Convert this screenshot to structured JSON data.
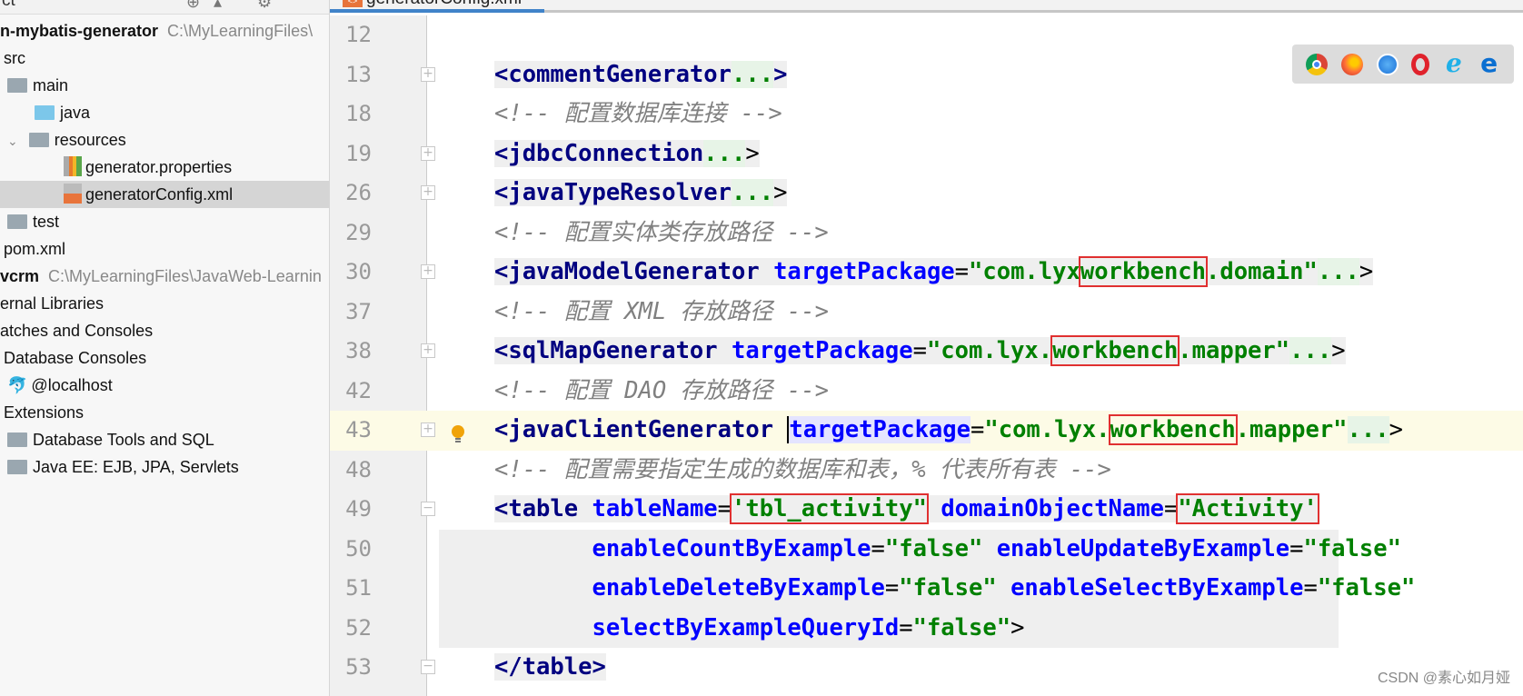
{
  "sidebar": {
    "header": "ct",
    "rows": [
      {
        "label": "n-mybatis-generator",
        "path": "C:\\MyLearningFiles\\"
      },
      {
        "label": "src"
      },
      {
        "label": "main"
      },
      {
        "label": "java"
      },
      {
        "label": "resources"
      },
      {
        "label": "generator.properties"
      },
      {
        "label": "generatorConfig.xml"
      },
      {
        "label": "test"
      },
      {
        "label": "pom.xml"
      },
      {
        "label": "vcrm",
        "path": "C:\\MyLearningFiles\\JavaWeb-Learnin"
      },
      {
        "label": "ernal Libraries"
      },
      {
        "label": "atches and Consoles"
      },
      {
        "label": "Database Consoles"
      },
      {
        "label": "@localhost"
      },
      {
        "label": "Extensions"
      },
      {
        "label": "Database Tools and SQL"
      },
      {
        "label": "Java EE: EJB, JPA, Servlets"
      }
    ]
  },
  "editor": {
    "tab": "generatorConfig.xml",
    "lines": [
      {
        "n": "12"
      },
      {
        "n": "13"
      },
      {
        "n": "18"
      },
      {
        "n": "19"
      },
      {
        "n": "26"
      },
      {
        "n": "29"
      },
      {
        "n": "30"
      },
      {
        "n": "37"
      },
      {
        "n": "38"
      },
      {
        "n": "42"
      },
      {
        "n": "43"
      },
      {
        "n": "48"
      },
      {
        "n": "49"
      },
      {
        "n": "50"
      },
      {
        "n": "51"
      },
      {
        "n": "52"
      },
      {
        "n": "53"
      }
    ],
    "code": {
      "l13": "<commentGenerator",
      "dots": "...",
      "l18": "<!-- 配置数据库连接 -->",
      "l19": "<jdbcConnection",
      "l26": "<javaTypeResolver",
      "l29": "<!-- 配置实体类存放路径 -->",
      "l30_tag": "<javaModelGenerator",
      "attr": "targetPackage",
      "l30_v1": "\"com.lyx",
      "wb": "workbench",
      "l30_v2": ".domain\"",
      "l37": "<!-- 配置 XML 存放路径 -->",
      "l38_tag": "<sqlMapGenerator",
      "mapper": ".mapper\"",
      "com": "\"com.lyx.",
      "l42": "<!-- 配置 DAO 存放路径 -->",
      "l43_tag": "<javaClientGenerator",
      "l48": "<!-- 配置需要指定生成的数据库和表，% 代表所有表 -->",
      "l49_tag": "<table",
      "l49_a1": "tableName",
      "l49_v1": "'tbl_activity\"",
      "l49_a2": "domainObjectName",
      "l49_v2": "\"Activity'",
      "l50_a1": "enableCountByExample",
      "l50_a2": "enableUpdateByExample",
      "false": "\"false\"",
      "l51_a1": "enableDeleteByExample",
      "l51_a2": "enableSelectByExample",
      "l52_a1": "selectByExampleQueryId",
      "l53": "</table>"
    }
  },
  "browsers": [
    "chrome-icon",
    "firefox-icon",
    "safari-icon",
    "opera-icon",
    "ie-icon",
    "edge-icon"
  ],
  "watermark": "CSDN @素心如月娅"
}
